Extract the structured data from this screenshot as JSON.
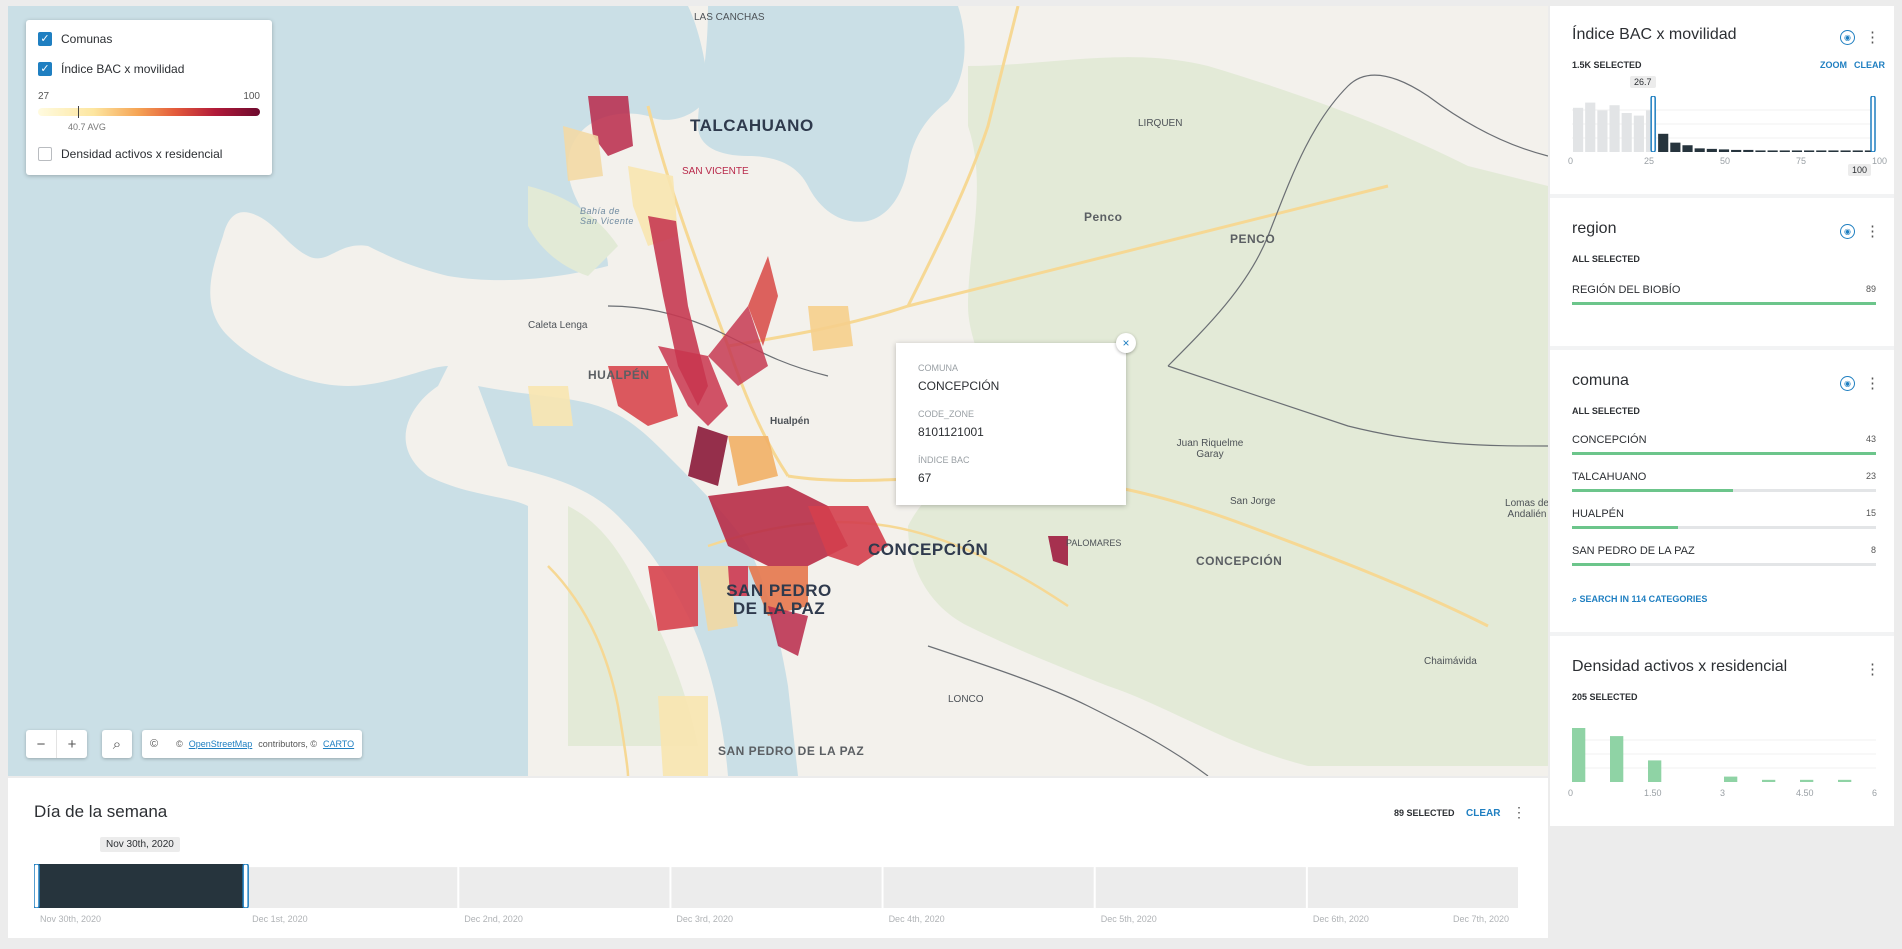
{
  "legend": {
    "layers": [
      {
        "label": "Comunas",
        "checked": true
      },
      {
        "label": "Índice BAC x movilidad",
        "checked": true
      },
      {
        "label": "Densidad activos x residencial",
        "checked": false
      }
    ],
    "ramp_min": "27",
    "ramp_max": "100",
    "avg_label": "40.7 AVG"
  },
  "map": {
    "place_labels": [
      "LAS CANCHAS",
      "TALCAHUANO",
      "SAN VICENTE",
      "Bahía de San Vicente",
      "Penco",
      "PENCO",
      "LIRQUEN",
      "Caleta Lenga",
      "HUALPÉN",
      "Hualpén",
      "CONCEPCIÓN",
      "SAN PEDRO DE LA PAZ",
      "Juan Riquelme Garay",
      "San Jorge",
      "PALOMARES",
      "CONCEPCIÓN",
      "Lomas de Andalién",
      "Chaimávida",
      "LONCO",
      "SAN PEDRO DE LA PAZ"
    ],
    "controls": {
      "zoom_out": "−",
      "zoom_in": "+",
      "search": "⌕",
      "info": "©"
    },
    "attribution": {
      "prefix": "©",
      "osm": "OpenStreetMap",
      "middle": "contributors, ©",
      "carto": "CARTO"
    }
  },
  "popup": {
    "close": "×",
    "fields": [
      {
        "label": "COMUNA",
        "value": "CONCEPCIÓN"
      },
      {
        "label": "CODE_ZONE",
        "value": "8101121001"
      },
      {
        "label": "ÍNDICE BAC",
        "value": "67"
      }
    ]
  },
  "timeline": {
    "title": "Día de la semana",
    "selected": "89 SELECTED",
    "clear": "CLEAR",
    "tooltip": "Nov 30th, 2020",
    "axis_labels": [
      "Nov 30th, 2020",
      "Dec 1st, 2020",
      "Dec 2nd, 2020",
      "Dec 3rd, 2020",
      "Dec 4th, 2020",
      "Dec 5th, 2020",
      "Dec 6th, 2020",
      "Dec 7th, 2020"
    ],
    "chart_data": {
      "type": "bar",
      "categories": [
        "Nov 30th, 2020",
        "Dec 1st, 2020",
        "Dec 2nd, 2020",
        "Dec 3rd, 2020",
        "Dec 4th, 2020",
        "Dec 5th, 2020",
        "Dec 6th, 2020"
      ],
      "values": [
        1.0,
        0.93,
        0.93,
        0.93,
        0.93,
        0.93,
        0.93
      ],
      "selected_index": 0,
      "colors": {
        "selected": "#26343d",
        "unselected": "#ececec"
      }
    }
  },
  "widgets": {
    "bac": {
      "title": "Índice BAC x movilidad",
      "selected": "1.5K SELECTED",
      "zoom": "ZOOM",
      "clear": "CLEAR",
      "range_min_label": "26.7",
      "range_max_label": "100",
      "ticks": [
        "0",
        "25",
        "50",
        "75",
        "100"
      ],
      "chart_data": {
        "type": "bar",
        "bin_width": 4,
        "xlim": [
          0,
          100
        ],
        "x": [
          2,
          6,
          10,
          14,
          18,
          22,
          26,
          30,
          34,
          38,
          42,
          46,
          50,
          54,
          58,
          62,
          66,
          70,
          74,
          78,
          82,
          86,
          90,
          94,
          98
        ],
        "values": [
          0.85,
          0.95,
          0.8,
          0.9,
          0.75,
          0.7,
          0.8,
          0.35,
          0.18,
          0.13,
          0.07,
          0.06,
          0.05,
          0.04,
          0.04,
          0.03,
          0.03,
          0.03,
          0.03,
          0.03,
          0.03,
          0.03,
          0.03,
          0.03,
          0.03
        ],
        "selection": [
          26.7,
          100
        ],
        "colors": {
          "selected": "#26343d",
          "unselected": "#e2e4e6"
        }
      }
    },
    "region": {
      "title": "region",
      "selected": "ALL SELECTED",
      "items": [
        {
          "name": "REGIÓN DEL BIOBÍO",
          "count": "89",
          "fraction": 1.0
        }
      ]
    },
    "comuna": {
      "title": "comuna",
      "selected": "ALL SELECTED",
      "items": [
        {
          "name": "CONCEPCIÓN",
          "count": "43",
          "fraction": 1.0
        },
        {
          "name": "TALCAHUANO",
          "count": "23",
          "fraction": 0.53
        },
        {
          "name": "HUALPÉN",
          "count": "15",
          "fraction": 0.35
        },
        {
          "name": "SAN PEDRO DE LA PAZ",
          "count": "8",
          "fraction": 0.19
        }
      ],
      "search": "SEARCH IN 114 CATEGORIES"
    },
    "densidad": {
      "title": "Densidad activos x residencial",
      "selected": "205 SELECTED",
      "ticks": [
        "0",
        "1.50",
        "3",
        "4.50",
        "6"
      ],
      "chart_data": {
        "type": "bar",
        "bin_width": 0.75,
        "xlim": [
          0,
          6
        ],
        "x": [
          0.375,
          1.125,
          1.875,
          2.625,
          3.375,
          4.125,
          4.875,
          5.625
        ],
        "values": [
          1.0,
          0.85,
          0.4,
          0.0,
          0.1,
          0.04,
          0.04,
          0.04
        ],
        "colors": {
          "bar": "#8fd3a5"
        }
      }
    }
  }
}
